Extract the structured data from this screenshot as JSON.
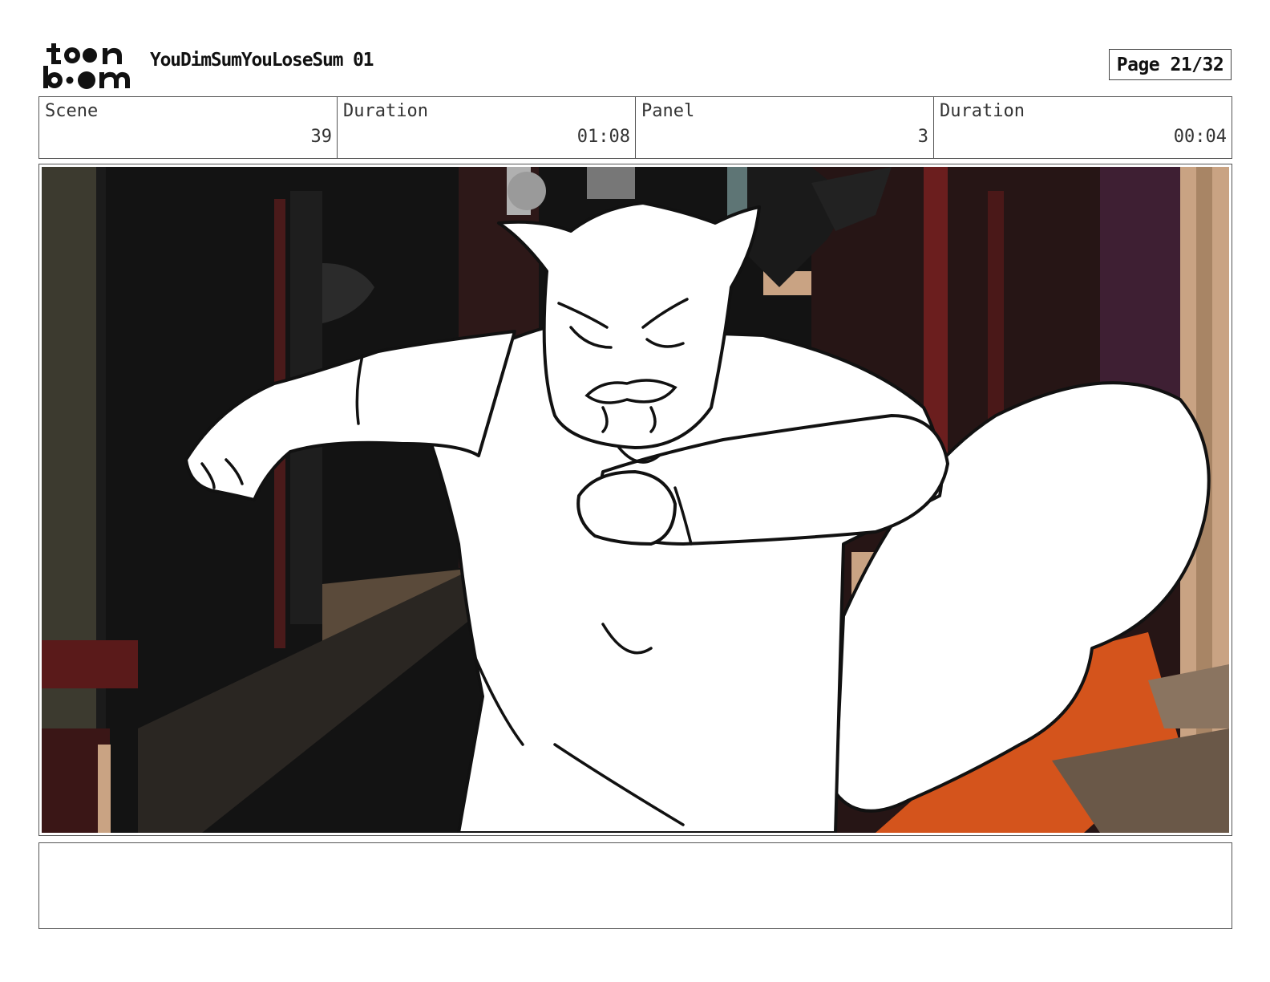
{
  "logo": {
    "line1": "toon",
    "line2": "boom"
  },
  "project": {
    "title": "YouDimSumYouLoseSum 01"
  },
  "page": {
    "label": "Page 21/32"
  },
  "info": {
    "scene_label": "Scene",
    "scene_value": "39",
    "scene_duration_label": "Duration",
    "scene_duration_value": "01:08",
    "panel_label": "Panel",
    "panel_value": "3",
    "panel_duration_label": "Duration",
    "panel_duration_value": "00:04"
  },
  "notes": {
    "text": ""
  },
  "colors": {
    "background_dark": "#131313",
    "wall_brown": "#3a1616",
    "beam_red": "#6b1e1e",
    "tan": "#c9a383",
    "orange": "#d4541c",
    "purple": "#3e1f33",
    "olive": "#3c3a2f"
  }
}
